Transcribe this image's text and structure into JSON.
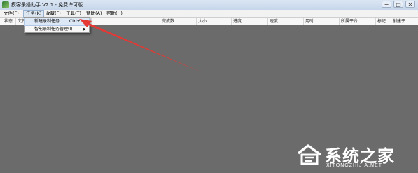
{
  "window": {
    "title": "摸客录播助手 V2.1 - 免费许可版",
    "controls": {
      "minimize": "−",
      "maximize": "□",
      "close": "✕"
    }
  },
  "menubar": {
    "items": [
      {
        "label": "文件(F)"
      },
      {
        "label": "任务(K)"
      },
      {
        "label": "收藏(F)"
      },
      {
        "label": "工具(T)"
      },
      {
        "label": "赞助(A)"
      },
      {
        "label": "帮助(H)"
      }
    ]
  },
  "columns": [
    "状态",
    "文件",
    "完成数",
    "大小",
    "进度",
    "速度",
    "用时",
    "所属平台",
    "标记",
    "创建于"
  ],
  "task_menu": {
    "items": [
      {
        "label": "新建录制任务",
        "shortcut": "Ctrl+N",
        "selected": true
      },
      {
        "label": "智能录制任务管理(I)",
        "has_submenu": true
      }
    ]
  },
  "annotation": {
    "arrow_color": "#e53935"
  },
  "watermark": {
    "text_cn": "系统之家",
    "text_en": "XITONGZHIJIA.NET"
  },
  "icons": {
    "app": "app-icon",
    "submenu": "chevron-right-icon",
    "watermark": "house-logo-icon"
  }
}
